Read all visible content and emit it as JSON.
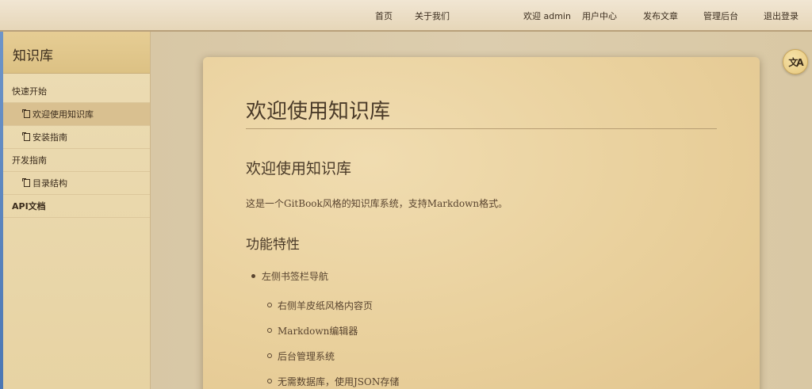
{
  "nav": {
    "home": "首页",
    "about": "关于我们",
    "welcome": "欢迎 admin",
    "user_center": "用户中心",
    "publish": "发布文章",
    "admin": "管理后台",
    "logout": "退出登录"
  },
  "sidebar": {
    "title": "知识库",
    "items": [
      {
        "label": "快速开始",
        "kind": "section"
      },
      {
        "label": "欢迎使用知识库",
        "kind": "page",
        "active": true
      },
      {
        "label": "安装指南",
        "kind": "page"
      },
      {
        "label": "开发指南",
        "kind": "section"
      },
      {
        "label": "目录结构",
        "kind": "page"
      },
      {
        "label": "API文档",
        "kind": "section"
      }
    ]
  },
  "article": {
    "title": "欢迎使用知识库",
    "heading": "欢迎使用知识库",
    "intro": "这是一个GitBook风格的知识库系统，支持Markdown格式。",
    "features_heading": "功能特性",
    "list_top": "左侧书签栏导航",
    "list_nested": [
      "右侧羊皮纸风格内容页",
      "Markdown编辑器",
      "后台管理系统",
      "无需数据库，使用JSON存储"
    ]
  },
  "translate_button": {
    "icon": "translate-icon",
    "glyph": "文A"
  },
  "colors": {
    "accent_strip": "#4b77b4",
    "paper": "#e9d09c",
    "sidebar_active": "#d9c090"
  }
}
